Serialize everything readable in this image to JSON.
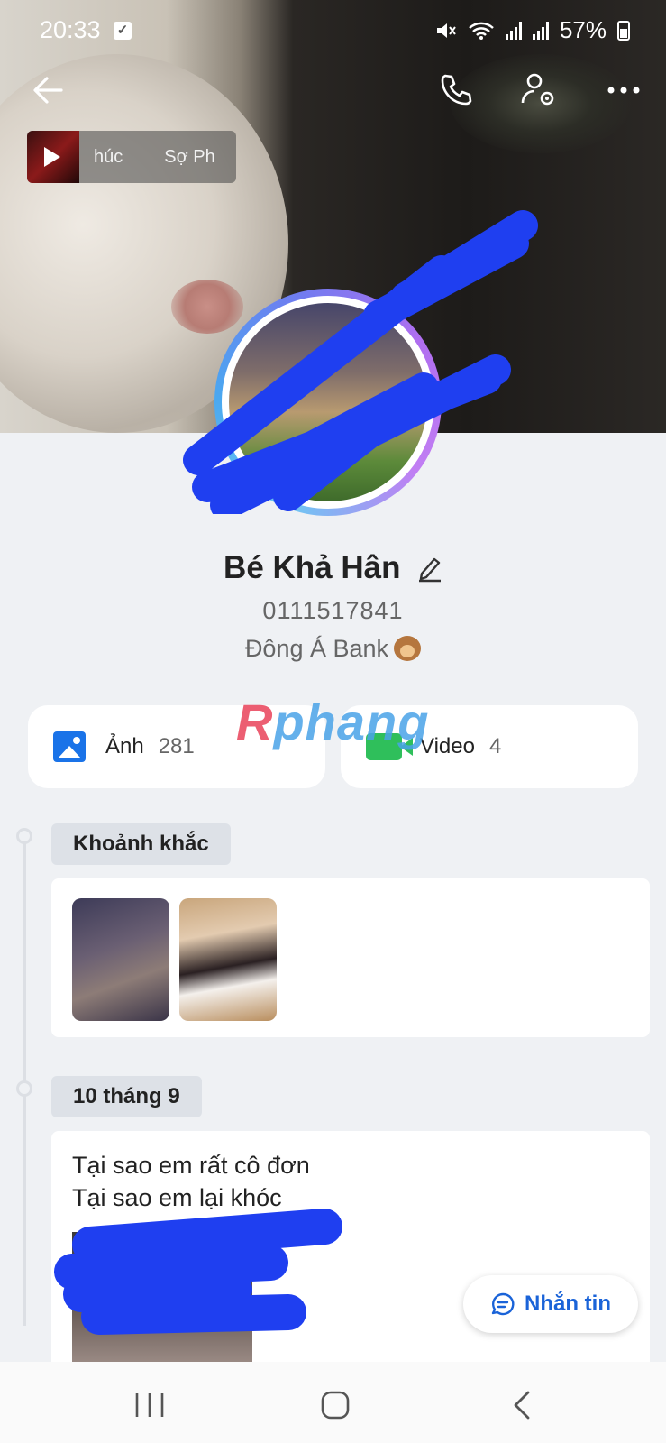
{
  "status_bar": {
    "time": "20:33",
    "battery": "57%"
  },
  "music": {
    "text_left": "húc",
    "text_right": "Sợ Ph"
  },
  "profile": {
    "name": "Bé Khả Hân",
    "phone": "0111517841",
    "bank": "Đông Á Bank"
  },
  "media": {
    "photo_label": "Ảnh",
    "photo_count": "281",
    "video_label": "Video",
    "video_count": "4"
  },
  "watermark": {
    "first": "R",
    "rest": "phang"
  },
  "timeline": {
    "moments_label": "Khoảnh khắc",
    "date_label": "10 tháng 9",
    "post_line1": "Tại sao em rất cô đơn",
    "post_line2": "Tại sao em lại khóc"
  },
  "message_button": {
    "label": "Nhắn tin"
  },
  "icons": [
    "back-icon",
    "phone-icon",
    "profile-settings-icon",
    "more-icon",
    "play-icon",
    "edit-icon",
    "photo-icon",
    "video-icon",
    "chat-icon"
  ],
  "colors": {
    "accent": "#1a63d8",
    "photo_icon": "#1a73e8",
    "video_icon": "#2fbf5b",
    "scribble": "#1f3ff0"
  }
}
